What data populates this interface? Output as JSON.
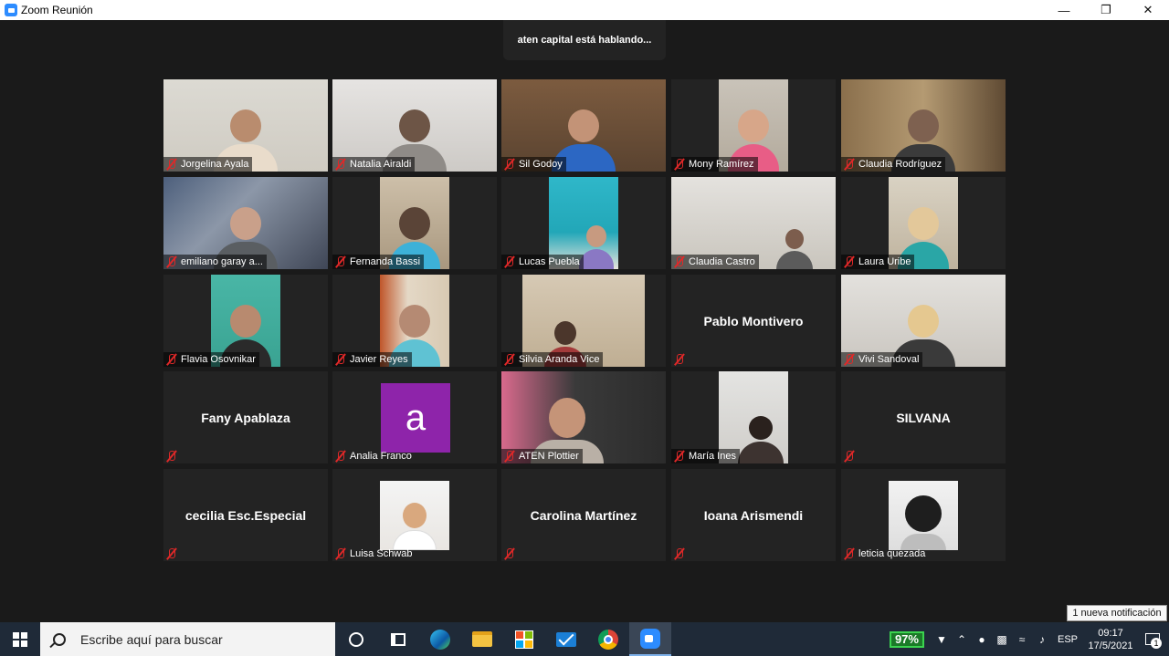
{
  "window": {
    "title": "Zoom Reunión"
  },
  "banner": {
    "speaking_text": "aten capital está hablando..."
  },
  "participants": [
    {
      "name": "Jorgelina Ayala",
      "kind": "video"
    },
    {
      "name": "Natalia Airaldi",
      "kind": "video"
    },
    {
      "name": "Sil Godoy",
      "kind": "video"
    },
    {
      "name": "Mony Ramírez",
      "kind": "video"
    },
    {
      "name": "Claudia Rodríguez",
      "kind": "video"
    },
    {
      "name": "emiliano garay a...",
      "kind": "video"
    },
    {
      "name": "Fernanda Bassi",
      "kind": "video"
    },
    {
      "name": "Lucas Puebla",
      "kind": "video"
    },
    {
      "name": "Claudia Castro",
      "kind": "video"
    },
    {
      "name": "Laura Uribe",
      "kind": "video"
    },
    {
      "name": "Flavia Osovnikar",
      "kind": "video"
    },
    {
      "name": "Javier Reyes",
      "kind": "video"
    },
    {
      "name": "Silvia Aranda Vice",
      "kind": "video"
    },
    {
      "name": "Pablo Montivero",
      "kind": "name"
    },
    {
      "name": "Vivi Sandoval",
      "kind": "video"
    },
    {
      "name": "Fany Apablaza",
      "kind": "name"
    },
    {
      "name": "Analia Franco",
      "kind": "avatar",
      "avatar_letter": "a"
    },
    {
      "name": "ATEN Plottier",
      "kind": "video"
    },
    {
      "name": "María Ines",
      "kind": "video"
    },
    {
      "name": "SILVANA",
      "kind": "name"
    },
    {
      "name": "cecilia Esc.Especial",
      "kind": "name"
    },
    {
      "name": "Luisa Schwab",
      "kind": "video"
    },
    {
      "name": "Carolina Martínez",
      "kind": "name"
    },
    {
      "name": "Ioana Arismendi",
      "kind": "name"
    },
    {
      "name": "leticia quezada",
      "kind": "video"
    }
  ],
  "notification": {
    "text": "1 nueva notificación"
  },
  "taskbar": {
    "search_placeholder": "Escribe aquí para buscar",
    "battery": "97%",
    "language": "ESP",
    "time": "09:17",
    "date": "17/5/2021",
    "notification_count": "1"
  },
  "colors": {
    "zoom_blue": "#2d8cff",
    "avatar_purple": "#8e24aa",
    "mic_muted_red": "#e02828"
  }
}
